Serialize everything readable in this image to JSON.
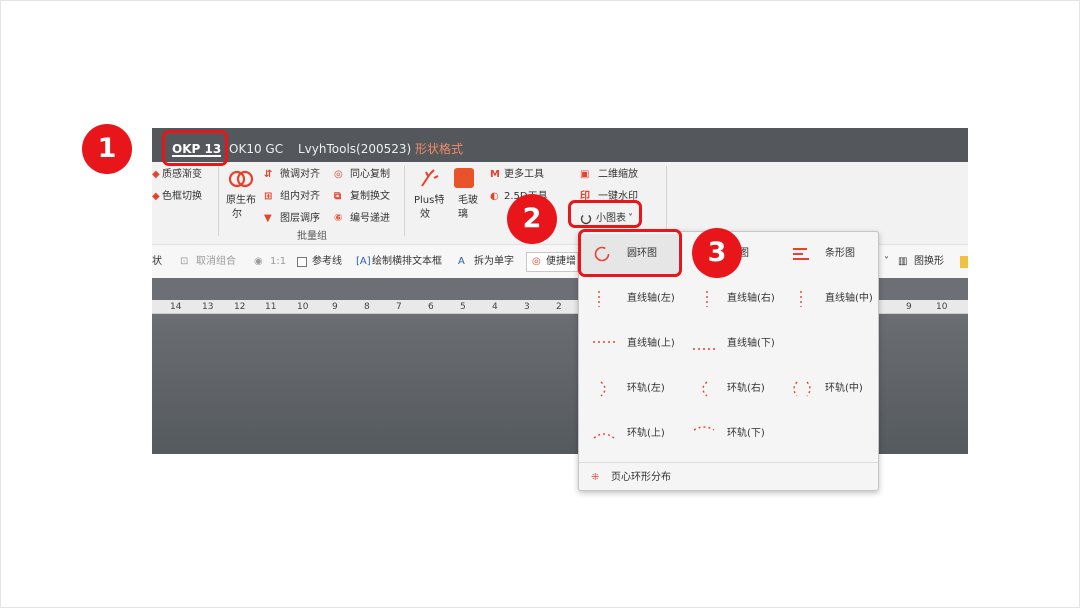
{
  "tabs": [
    "OKP 13",
    "OK10 GC",
    "LvyhTools(200523)",
    "形状格式"
  ],
  "ribbon": {
    "partial_items": [
      "质感渐变",
      "色框切换"
    ],
    "big_button_1": [
      "原生布",
      "尔"
    ],
    "align_items": [
      "微调对齐",
      "组内对齐",
      "图层调序"
    ],
    "copy_items": [
      "同心复制",
      "复制换文",
      "编号递进"
    ],
    "group_label": "批量组",
    "plus_effect": [
      "Plus特",
      "效"
    ],
    "glass": [
      "毛玻",
      "璃"
    ],
    "more_tools": "更多工具",
    "tool_2": "2.5D工具",
    "qr_zoom": "二维缩放",
    "watermark": "一键水印",
    "small_chart": "小图表"
  },
  "toolbar": {
    "items": [
      "状",
      "取消组合",
      "1:1",
      "参考线",
      "绘制横排文本框",
      "拆为单字",
      "便捷增",
      "图换形"
    ]
  },
  "ruler": {
    "ticks": [
      "14",
      "13",
      "12",
      "11",
      "10",
      "9",
      "8",
      "7",
      "6",
      "5",
      "4",
      "3",
      "2",
      "9",
      "10"
    ]
  },
  "dropdown": {
    "items": [
      {
        "label": "圆环图",
        "icon": "ring-icon"
      },
      {
        "label": "图",
        "icon": "pie-icon"
      },
      {
        "label": "条形图",
        "icon": "bar-icon"
      },
      {
        "label": "直线轴(左)",
        "icon": "axis-left-icon"
      },
      {
        "label": "直线轴(右)",
        "icon": "axis-right-icon"
      },
      {
        "label": "直线轴(中)",
        "icon": "axis-center-icon"
      },
      {
        "label": "直线轴(上)",
        "icon": "axis-top-icon"
      },
      {
        "label": "直线轴(下)",
        "icon": "axis-bottom-icon"
      },
      {
        "label": "环轨(左)",
        "icon": "orbit-left-icon"
      },
      {
        "label": "环轨(右)",
        "icon": "orbit-right-icon"
      },
      {
        "label": "环轨(中)",
        "icon": "orbit-center-icon"
      },
      {
        "label": "环轨(上)",
        "icon": "orbit-top-icon"
      },
      {
        "label": "环轨(下)",
        "icon": "orbit-bottom-icon"
      }
    ],
    "footer": "页心环形分布"
  },
  "annotations": [
    "1",
    "2",
    "3"
  ],
  "colors": {
    "accent": "#e8412c",
    "highlight": "#e8151b",
    "tabbar": "#54585d",
    "ribbon": "#f2f2f2"
  }
}
